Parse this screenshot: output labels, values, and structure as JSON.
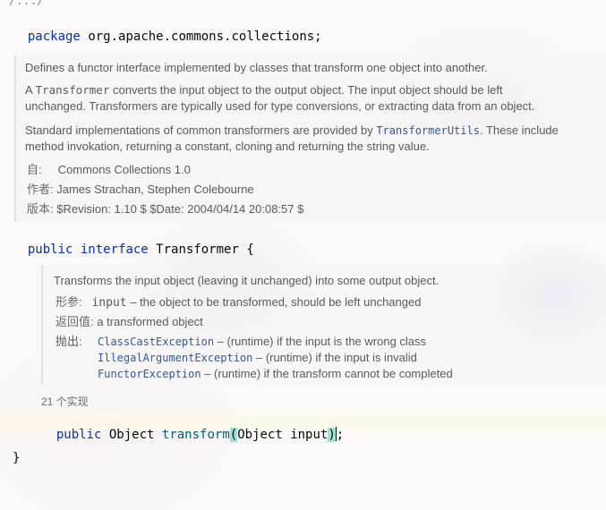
{
  "editor": {
    "fold_marker": "/.../",
    "package_line": {
      "keyword": "package",
      "name": "org.apache.commons.collections;"
    },
    "class_doc": {
      "summary": "Defines a functor interface implemented by classes that transform one object into another.",
      "p1_a": "A ",
      "p1_code": "Transformer",
      "p1_b": " converts the input object to the output object. The input object should be left",
      "p1_c": "unchanged. Transformers are typically used for type conversions, or extracting data from an object.",
      "p2_a": "Standard implementations of common transformers are provided by ",
      "p2_link": "TransformerUtils",
      "p2_b": ". These include",
      "p2_c": "method invokation, returning a constant, cloning and returning the string value.",
      "since_label": "自:",
      "since_value": "Commons Collections 1.0",
      "author_label": "作者:",
      "author_value": "James Strachan, Stephen Colebourne",
      "version_label": "版本:",
      "version_value": "$Revision: 1.10 $ $Date: 2004/04/14 20:08:57 $"
    },
    "interface_line": {
      "kw1": "public",
      "kw2": "interface",
      "name": "Transformer",
      "brace": "{"
    },
    "method_doc": {
      "summary": "Transforms the input object (leaving it unchanged) into some output object.",
      "params_label": "形参:",
      "param_name": "input",
      "param_desc": " – the object to be transformed, should be left unchanged",
      "returns_label": "返回值:",
      "returns_value": "a transformed object",
      "throws_label": "抛出:",
      "throws": [
        {
          "exception": "ClassCastException",
          "desc": " – (runtime) if the input is the wrong class"
        },
        {
          "exception": "IllegalArgumentException",
          "desc": " – (runtime) if the input is invalid"
        },
        {
          "exception": "FunctorException",
          "desc": " – (runtime) if the transform cannot be completed"
        }
      ]
    },
    "implementations_hint": "21 个实现",
    "method_line": {
      "kw": "public",
      "type": "Object",
      "name": "transform",
      "open_paren": "(",
      "params": "Object input",
      "close_paren": ")",
      "semi": ";"
    },
    "closing_brace": "}"
  }
}
